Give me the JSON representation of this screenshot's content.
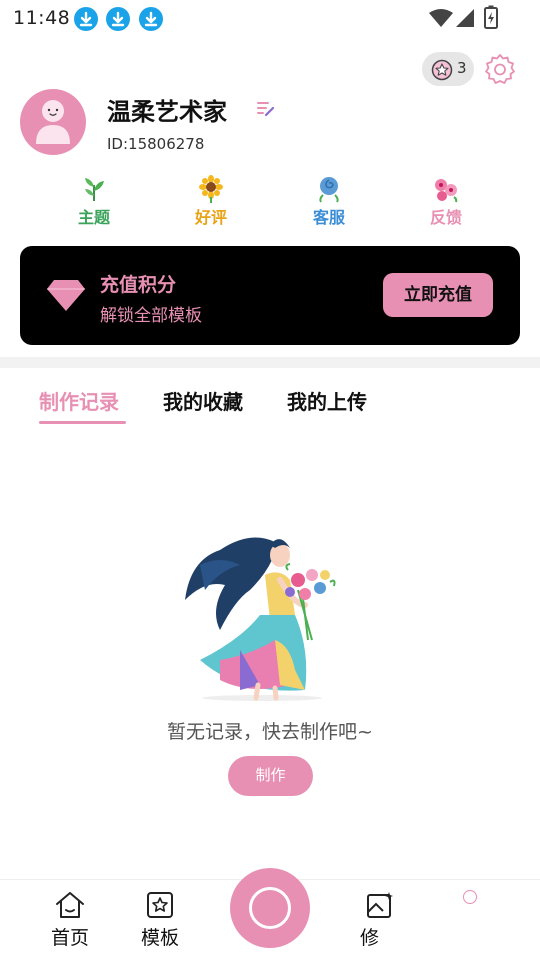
{
  "status_bar": {
    "time": "11:48",
    "icons": [
      "download-icon",
      "download-icon",
      "download-icon",
      "wifi-icon",
      "signal-icon",
      "battery-icon"
    ]
  },
  "header": {
    "points_count": "3",
    "username": "温柔艺术家",
    "user_id": "ID:15806278"
  },
  "quick_actions": [
    {
      "label": "主题",
      "icon": "leaf-icon",
      "color": "#3aa35a"
    },
    {
      "label": "好评",
      "icon": "sunflower-icon",
      "color": "#e8a317"
    },
    {
      "label": "客服",
      "icon": "blue-rose-icon",
      "color": "#3b8ed6"
    },
    {
      "label": "反馈",
      "icon": "pink-flower-icon",
      "color": "#e890b3"
    }
  ],
  "recharge": {
    "title": "充值积分",
    "subtitle": "解锁全部模板",
    "button_label": "立即充值"
  },
  "tabs": [
    {
      "label": "制作记录",
      "active": true
    },
    {
      "label": "我的收藏",
      "active": false
    },
    {
      "label": "我的上传",
      "active": false
    }
  ],
  "empty_state": {
    "message": "暂无记录，快去制作吧~",
    "button_label": "制作"
  },
  "bottom_nav": [
    {
      "label": "首页",
      "icon": "home-icon"
    },
    {
      "label": "模板",
      "icon": "template-star-icon"
    },
    {
      "label": "修",
      "icon": "edit-image-icon"
    }
  ],
  "colors": {
    "accent": "#e890b3",
    "card_bg": "#000000",
    "download_blue": "#1aa3e8"
  }
}
